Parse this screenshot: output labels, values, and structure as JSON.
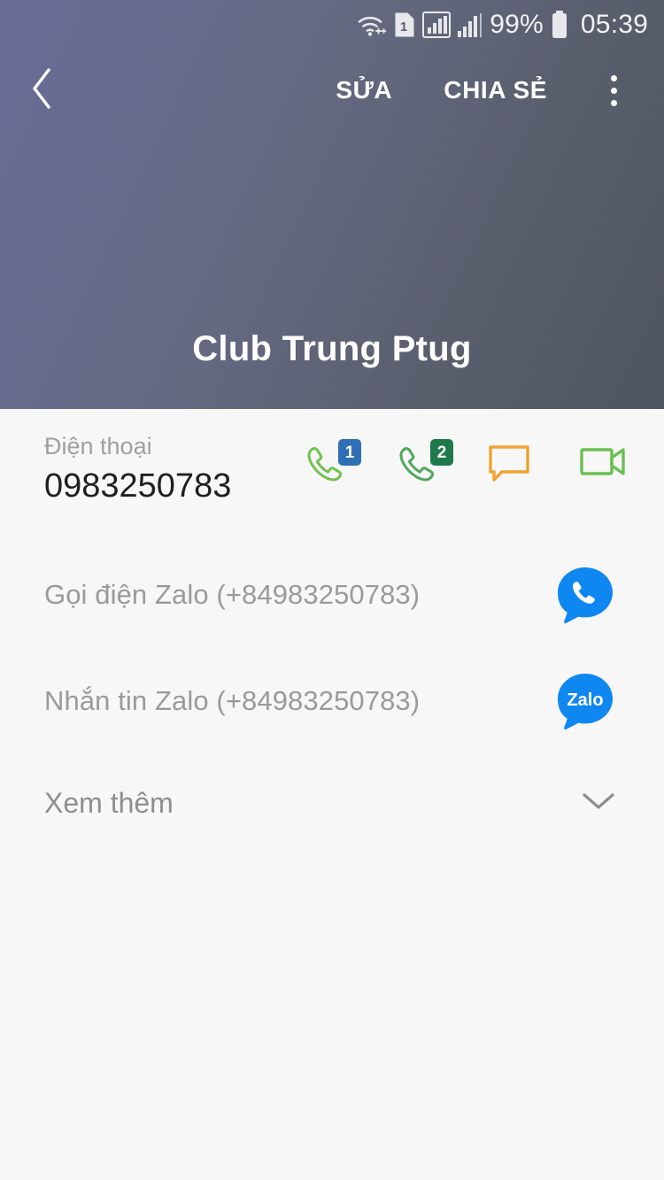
{
  "statusbar": {
    "wifi_icon": "wifi-icon",
    "sim_indicator": "1",
    "signal1_icon": "signal-bars-boxed-icon",
    "signal2_icon": "signal-bars-icon",
    "battery_percent": "99%",
    "battery_icon": "battery-full-icon",
    "time": "05:39"
  },
  "toolbar": {
    "back_icon": "back-chevron-icon",
    "edit_label": "SỬA",
    "share_label": "CHIA SẺ",
    "overflow_icon": "more-vertical-icon"
  },
  "header": {
    "contact_name": "Club Trung Ptug",
    "gradient_start": "#6a6d98",
    "gradient_end": "#4f5463"
  },
  "phone": {
    "label": "Điện thoại",
    "number": "0983250783",
    "actions": [
      {
        "name": "call-sim1",
        "icon": "phone-handset-icon",
        "badge": "1",
        "badge_color": "#2f6fb5",
        "icon_color": "#72c14f"
      },
      {
        "name": "call-sim2",
        "icon": "phone-handset-icon",
        "badge": "2",
        "badge_color": "#1e7a4a",
        "icon_color": "#4fa85a"
      },
      {
        "name": "send-message",
        "icon": "message-bubble-icon",
        "badge": "",
        "badge_color": "",
        "icon_color": "#f0a330"
      },
      {
        "name": "video-call",
        "icon": "video-camera-icon",
        "badge": "",
        "badge_color": "",
        "icon_color": "#6cbf52"
      }
    ]
  },
  "zalo_call": {
    "label": "Gọi điện Zalo (+84983250783)",
    "icon": "zalo-call-icon",
    "icon_color": "#0e87f0"
  },
  "zalo_message": {
    "label": "Nhắn tin Zalo (+84983250783)",
    "icon": "zalo-message-icon",
    "icon_text": "Zalo",
    "icon_color": "#0e87f0"
  },
  "more": {
    "label": "Xem thêm",
    "icon": "chevron-down-icon"
  }
}
